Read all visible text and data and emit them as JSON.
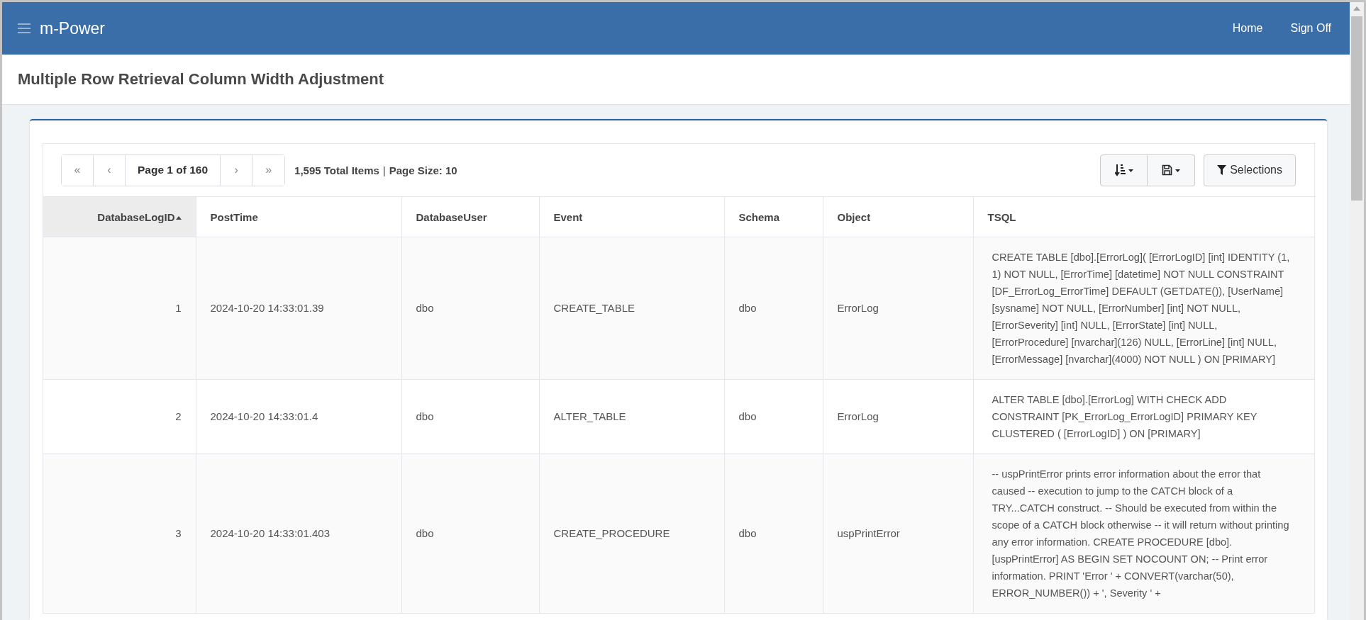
{
  "navbar": {
    "brand": "m-Power",
    "links": [
      "Home",
      "Sign Off"
    ]
  },
  "page_title": "Multiple Row Retrieval Column Width Adjustment",
  "pager": {
    "first": "«",
    "previous": "‹",
    "page_label": "Page 1 of 160",
    "next": "›",
    "last": "»",
    "summary_count": "1,595 Total Items",
    "separator": "|",
    "summary_size": "Page Size: 10"
  },
  "toolbar": {
    "selections_label": "Selections"
  },
  "table": {
    "columns": [
      {
        "label": "DatabaseLogID",
        "sorted": true
      },
      {
        "label": "PostTime",
        "sorted": false
      },
      {
        "label": "DatabaseUser",
        "sorted": false
      },
      {
        "label": "Event",
        "sorted": false
      },
      {
        "label": "Schema",
        "sorted": false
      },
      {
        "label": "Object",
        "sorted": false
      },
      {
        "label": "TSQL",
        "sorted": false
      }
    ],
    "rows": [
      [
        "1",
        "2024-10-20 14:33:01.39",
        "dbo",
        "CREATE_TABLE",
        "dbo",
        "ErrorLog",
        "CREATE TABLE [dbo].[ErrorLog]( [ErrorLogID] [int] IDENTITY (1, 1) NOT NULL, [ErrorTime] [datetime] NOT NULL CONSTRAINT [DF_ErrorLog_ErrorTime] DEFAULT (GETDATE()), [UserName] [sysname] NOT NULL, [ErrorNumber] [int] NOT NULL, [ErrorSeverity] [int] NULL, [ErrorState] [int] NULL, [ErrorProcedure] [nvarchar](126) NULL, [ErrorLine] [int] NULL, [ErrorMessage] [nvarchar](4000) NOT NULL ) ON [PRIMARY]"
      ],
      [
        "2",
        "2024-10-20 14:33:01.4",
        "dbo",
        "ALTER_TABLE",
        "dbo",
        "ErrorLog",
        "ALTER TABLE [dbo].[ErrorLog] WITH CHECK ADD CONSTRAINT [PK_ErrorLog_ErrorLogID] PRIMARY KEY CLUSTERED ( [ErrorLogID] ) ON [PRIMARY]"
      ],
      [
        "3",
        "2024-10-20 14:33:01.403",
        "dbo",
        "CREATE_PROCEDURE",
        "dbo",
        "uspPrintError",
        "-- uspPrintError prints error information about the error that caused -- execution to jump to the CATCH block of a TRY...CATCH construct. -- Should be executed from within the scope of a CATCH block otherwise -- it will return without printing any error information. CREATE PROCEDURE [dbo].[uspPrintError] AS BEGIN SET NOCOUNT ON; -- Print error information. PRINT 'Error ' + CONVERT(varchar(50), ERROR_NUMBER()) + ', Severity ' +"
      ]
    ]
  }
}
